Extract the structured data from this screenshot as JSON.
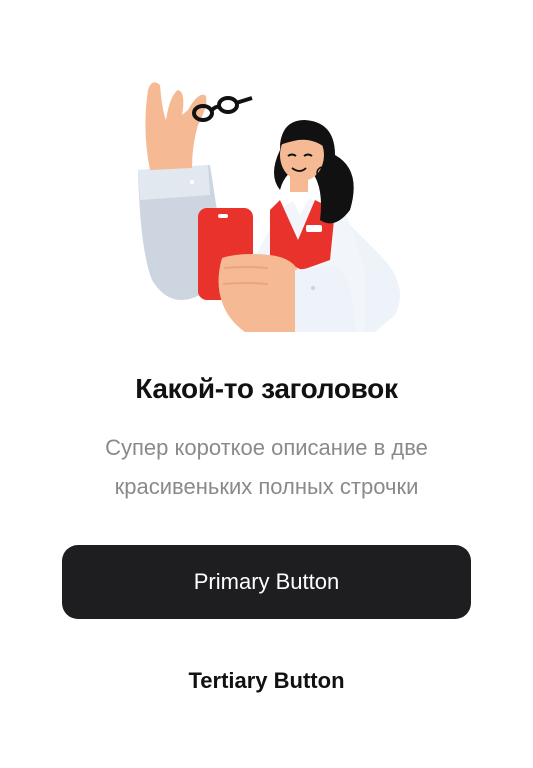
{
  "illustration": {
    "description_icon": "pharmacist-with-glasses-illustration"
  },
  "content": {
    "title": "Какой-то заголовок",
    "subtitle_line1": "Супер короткое описание в две",
    "subtitle_line2": "красивеньких полных строчки"
  },
  "actions": {
    "primary_label": "Primary Button",
    "tertiary_label": "Tertiary Button"
  },
  "colors": {
    "primary_button_bg": "#1e1e20",
    "accent_red": "#e8322b",
    "skin": "#f5b993",
    "coat": "#eef3fa"
  }
}
